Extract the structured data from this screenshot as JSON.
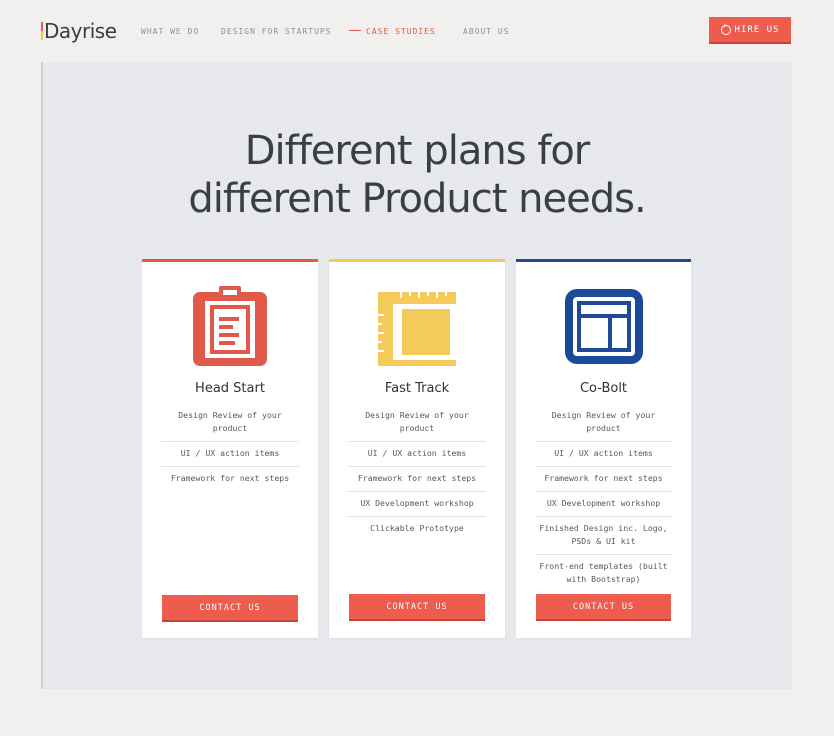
{
  "brand": {
    "name": "Dayrise",
    "accent": "#ee5c4e"
  },
  "nav": {
    "items": [
      {
        "label": "WHAT WE DO"
      },
      {
        "label": "DESIGN FOR STARTUPS"
      },
      {
        "label": "CASE STUDIES",
        "active": true
      },
      {
        "label": "ABOUT US"
      }
    ],
    "cta_label": "HIRE US"
  },
  "hero": {
    "line1": "Different plans for",
    "line2": "different Product needs."
  },
  "plans": [
    {
      "name": "Head Start",
      "color": "#e0594a",
      "icon": "clipboard-icon",
      "features": [
        "Design Review of your product",
        "UI / UX action items",
        "Framework for next steps"
      ],
      "button": "CONTACT US"
    },
    {
      "name": "Fast Track",
      "color": "#f4cb5a",
      "icon": "ruler-frame-icon",
      "features": [
        "Design Review of your product",
        "UI / UX action items",
        "Framework for next steps",
        "UX Development workshop",
        "Clickable Prototype"
      ],
      "button": "CONTACT US"
    },
    {
      "name": "Co-Bolt",
      "color": "#1c4a99",
      "icon": "layout-window-icon",
      "features": [
        "Design Review of your product",
        "UI / UX action items",
        "Framework for next steps",
        "UX Development workshop",
        "Finished Design inc. Logo, PSDs & UI kit",
        "Front-end templates (built with Bootstrap)"
      ],
      "button": "CONTACT US"
    }
  ]
}
